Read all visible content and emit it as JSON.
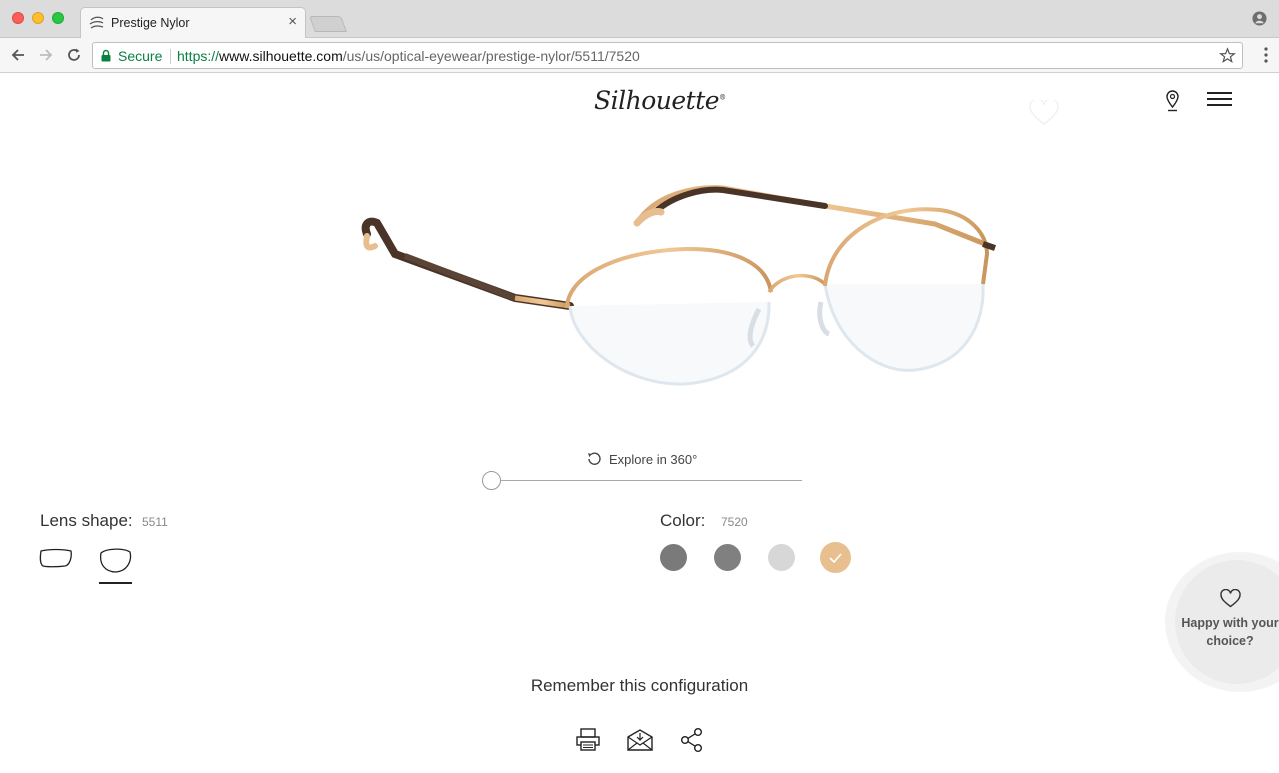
{
  "browser": {
    "tab_title": "Prestige Nylor",
    "secure_label": "Secure",
    "url_scheme": "https://",
    "url_host": "www.silhouette.com",
    "url_path": "/us/us/optical-eyewear/prestige-nylor/5511/7520"
  },
  "header": {
    "logo_text": "Silhouette",
    "logo_mark": "®"
  },
  "viewer": {
    "explore_label": "Explore in 360°",
    "rotation_position": 0
  },
  "lens": {
    "label": "Lens shape:",
    "code": "5511",
    "selected_index": 1
  },
  "color": {
    "label": "Color:",
    "code": "7520",
    "swatches": [
      "#7a7a7a",
      "#808080",
      "#d7d7d7",
      "#e8c08f"
    ],
    "selected_index": 3
  },
  "happy_widget": {
    "text": "Happy with your choice?"
  },
  "remember": {
    "label": "Remember this configuration"
  }
}
